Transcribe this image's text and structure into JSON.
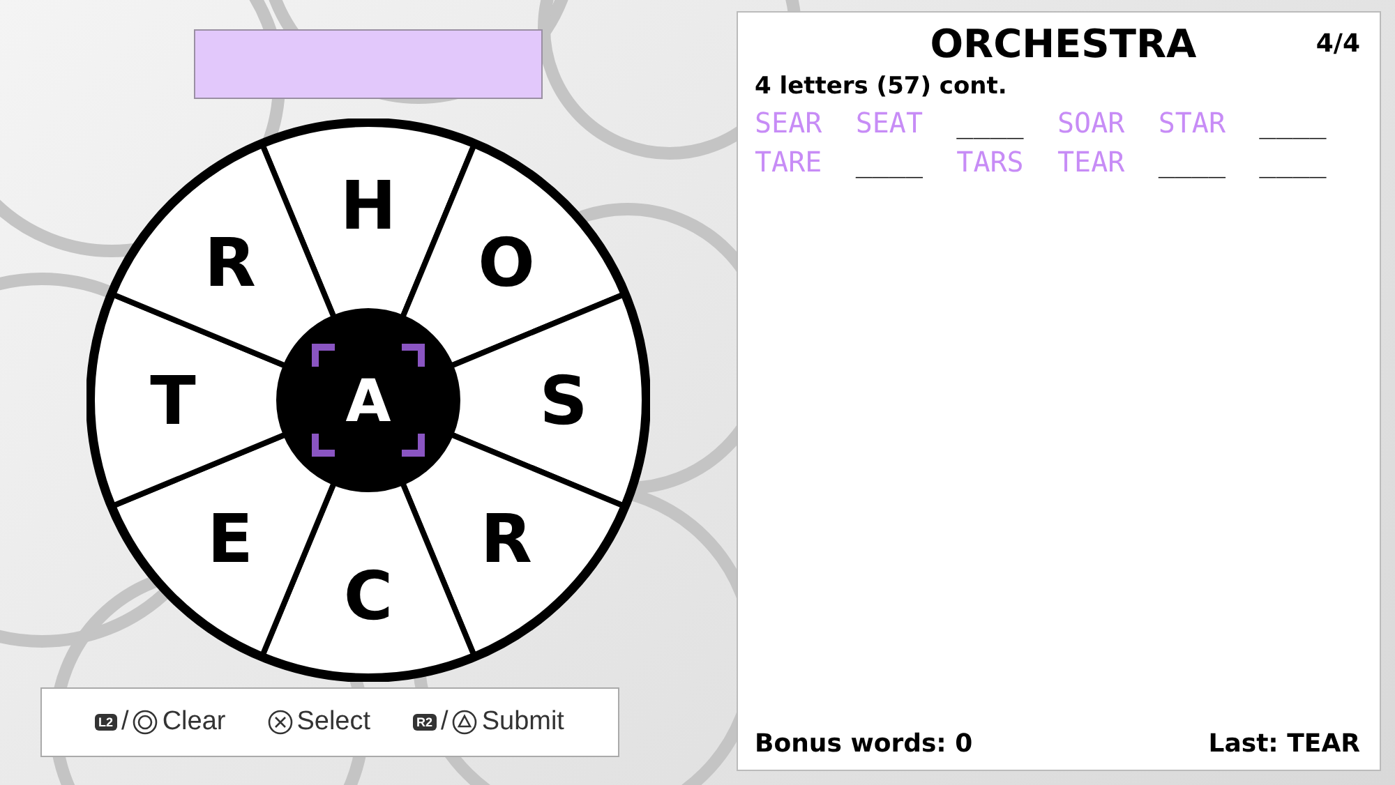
{
  "wheel": {
    "center": "A",
    "letters": [
      "H",
      "O",
      "S",
      "R",
      "C",
      "E",
      "T",
      "R"
    ]
  },
  "hints": [
    {
      "badge": "L2",
      "separator": "/",
      "kind": "circle",
      "label": "Clear"
    },
    {
      "kind": "cross",
      "label": "Select"
    },
    {
      "badge": "R2",
      "separator": "/",
      "kind": "triangle",
      "label": "Submit"
    }
  ],
  "panel": {
    "title": "ORCHESTRA",
    "page": "4/4",
    "section": "4 letters (57) cont.",
    "words": [
      {
        "text": "SEAR",
        "found": true
      },
      {
        "text": "SEAT",
        "found": true
      },
      {
        "text": "____",
        "found": false
      },
      {
        "text": "SOAR",
        "found": true
      },
      {
        "text": "STAR",
        "found": true
      },
      {
        "text": "____",
        "found": false
      },
      {
        "text": "TARE",
        "found": true
      },
      {
        "text": "____",
        "found": false
      },
      {
        "text": "TARS",
        "found": true
      },
      {
        "text": "TEAR",
        "found": true
      },
      {
        "text": "____",
        "found": false
      },
      {
        "text": "____",
        "found": false
      }
    ],
    "bonus": "Bonus words: 0",
    "last": "Last: TEAR"
  }
}
